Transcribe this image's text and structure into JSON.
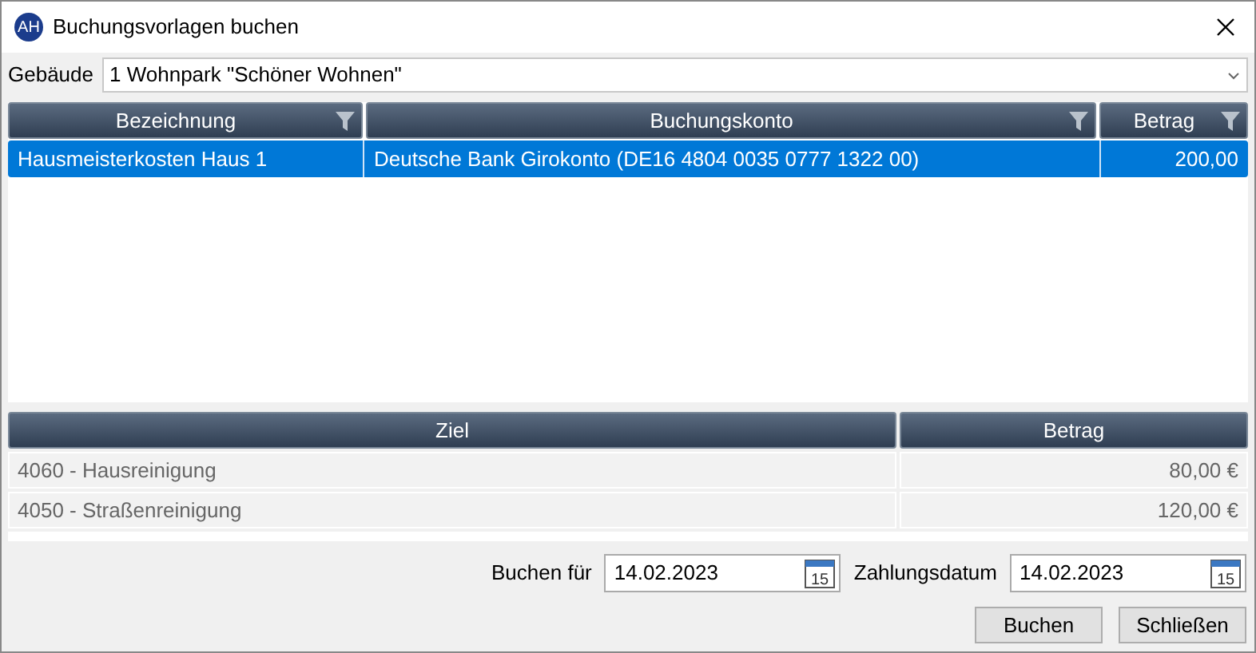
{
  "window": {
    "title": "Buchungsvorlagen buchen",
    "logo": "AH"
  },
  "building": {
    "label": "Gebäude",
    "value": "1 Wohnpark \"Schöner Wohnen\""
  },
  "templates": {
    "columns": [
      {
        "label": "Bezeichnung",
        "filter": true
      },
      {
        "label": "Buchungskonto",
        "filter": true
      },
      {
        "label": "Betrag",
        "filter": true
      }
    ],
    "rows": [
      {
        "cells": [
          "Hausmeisterkosten Haus 1",
          "Deutsche Bank Girokonto (DE16 4804 0035 0777 1322 00)",
          "200,00"
        ],
        "selected": true
      }
    ]
  },
  "targets": {
    "columns": [
      {
        "label": "Ziel"
      },
      {
        "label": "Betrag"
      }
    ],
    "rows": [
      {
        "cells": [
          "4060 - Hausreinigung",
          "80,00 €"
        ]
      },
      {
        "cells": [
          "4050 - Straßenreinigung",
          "120,00 €"
        ]
      }
    ]
  },
  "dates": [
    {
      "label": "Buchen für",
      "value": "14.02.2023",
      "icon_text": "15"
    },
    {
      "label": "Zahlungsdatum",
      "value": "14.02.2023",
      "icon_text": "15"
    }
  ],
  "buttons": [
    "Buchen",
    "Schließen"
  ]
}
